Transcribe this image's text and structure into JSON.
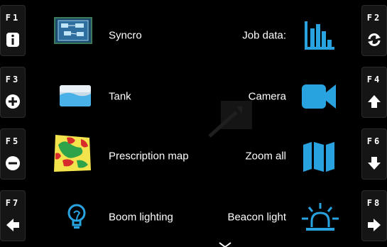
{
  "function_keys": {
    "f1": {
      "label": "F1",
      "icon": "info-icon"
    },
    "f2": {
      "label": "F2",
      "icon": "refresh-icon"
    },
    "f3": {
      "label": "F3",
      "icon": "plus-circle-icon"
    },
    "f4": {
      "label": "F4",
      "icon": "arrow-up-icon"
    },
    "f5": {
      "label": "F5",
      "icon": "minus-circle-icon"
    },
    "f6": {
      "label": "F6",
      "icon": "arrow-down-icon"
    },
    "f7": {
      "label": "F7",
      "icon": "arrow-left-icon"
    },
    "f8": {
      "label": "F8",
      "icon": "arrow-right-icon"
    }
  },
  "menu": {
    "syncro": {
      "label": "Syncro",
      "icon": "syncro-icon"
    },
    "job_data": {
      "label": "Job data:",
      "icon": "bar-chart-icon"
    },
    "tank": {
      "label": "Tank",
      "icon": "tank-icon"
    },
    "camera": {
      "label": "Camera",
      "icon": "camera-icon"
    },
    "prescription_map": {
      "label": "Prescription map",
      "icon": "prescription-map-icon"
    },
    "zoom_all": {
      "label": "Zoom all",
      "icon": "map-icon"
    },
    "boom_lighting": {
      "label": "Boom lighting",
      "icon": "lightbulb-icon"
    },
    "beacon_light": {
      "label": "Beacon light",
      "icon": "beacon-icon"
    }
  },
  "colors": {
    "accent_blue": "#29a3e0",
    "panel": "#151515",
    "background": "#000000"
  }
}
